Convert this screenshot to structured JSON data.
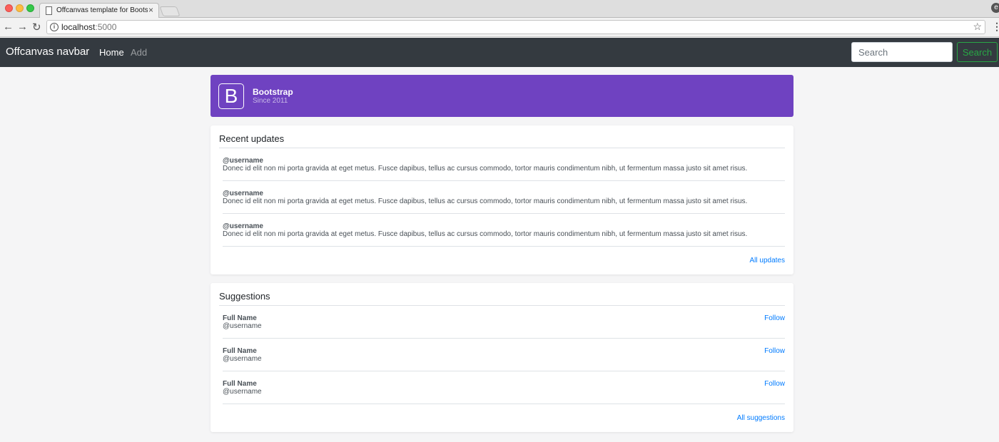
{
  "browser": {
    "tab_title": "Offcanvas template for Bootstrap",
    "tab_close": "×",
    "url_host": "localhost",
    "url_port": ":5000",
    "profile_letter": "e"
  },
  "navbar": {
    "brand": "Offcanvas navbar",
    "links": [
      "Home",
      "Add"
    ],
    "search_placeholder": "Search",
    "search_button": "Search"
  },
  "banner": {
    "logo_letter": "B",
    "title": "Bootstrap",
    "subtitle": "Since 2011",
    "color": "#6f42c1"
  },
  "recent_updates": {
    "title": "Recent updates",
    "items": [
      {
        "user": "@username",
        "text": "Donec id elit non mi porta gravida at eget metus. Fusce dapibus, tellus ac cursus commodo, tortor mauris condimentum nibh, ut fermentum massa justo sit amet risus."
      },
      {
        "user": "@username",
        "text": "Donec id elit non mi porta gravida at eget metus. Fusce dapibus, tellus ac cursus commodo, tortor mauris condimentum nibh, ut fermentum massa justo sit amet risus."
      },
      {
        "user": "@username",
        "text": "Donec id elit non mi porta gravida at eget metus. Fusce dapibus, tellus ac cursus commodo, tortor mauris condimentum nibh, ut fermentum massa justo sit amet risus."
      }
    ],
    "footer_link": "All updates"
  },
  "suggestions": {
    "title": "Suggestions",
    "items": [
      {
        "name": "Full Name",
        "user": "@username",
        "action": "Follow"
      },
      {
        "name": "Full Name",
        "user": "@username",
        "action": "Follow"
      },
      {
        "name": "Full Name",
        "user": "@username",
        "action": "Follow"
      }
    ],
    "footer_link": "All suggestions"
  },
  "colors": {
    "navbar_bg": "#343a40",
    "success": "#28a745",
    "link": "#007bff"
  }
}
